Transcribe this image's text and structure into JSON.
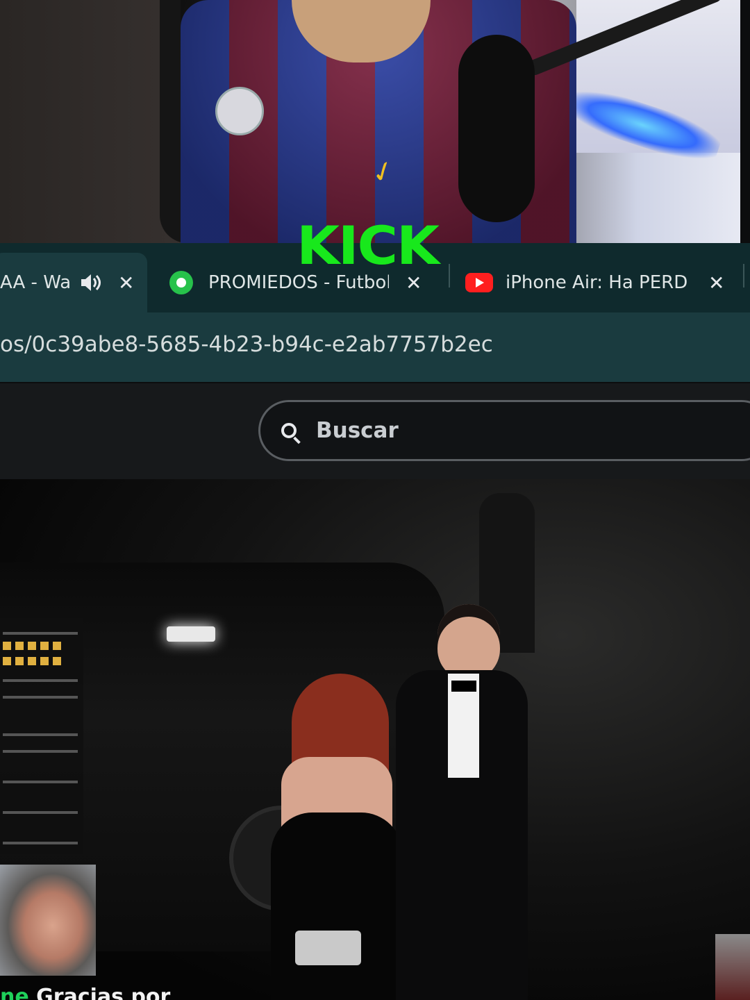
{
  "stream_overlay": {
    "logo_text": "KICK"
  },
  "browser": {
    "tabs": [
      {
        "title": "AA - Wa",
        "icon": "speaker-icon",
        "active": true
      },
      {
        "title": "PROMIEDOS - Futbol",
        "icon": "soccer-ball-icon",
        "active": false
      },
      {
        "title": "iPhone Air: Ha PERDI",
        "icon": "youtube-icon",
        "active": false
      }
    ],
    "close_glyph": "✕",
    "url": "os/0c39abe8-5685-4b23-b94c-e2ab7757b2ec"
  },
  "page": {
    "search": {
      "placeholder": "Buscar"
    }
  },
  "video": {
    "caption_highlight": "ne",
    "caption_text": " Gracias por"
  },
  "colors": {
    "kick_green": "#18e81c",
    "tabbar_bg": "#0f2a2d",
    "active_tab_bg": "#1a3b3f",
    "youtube_red": "#ff1f1f"
  }
}
